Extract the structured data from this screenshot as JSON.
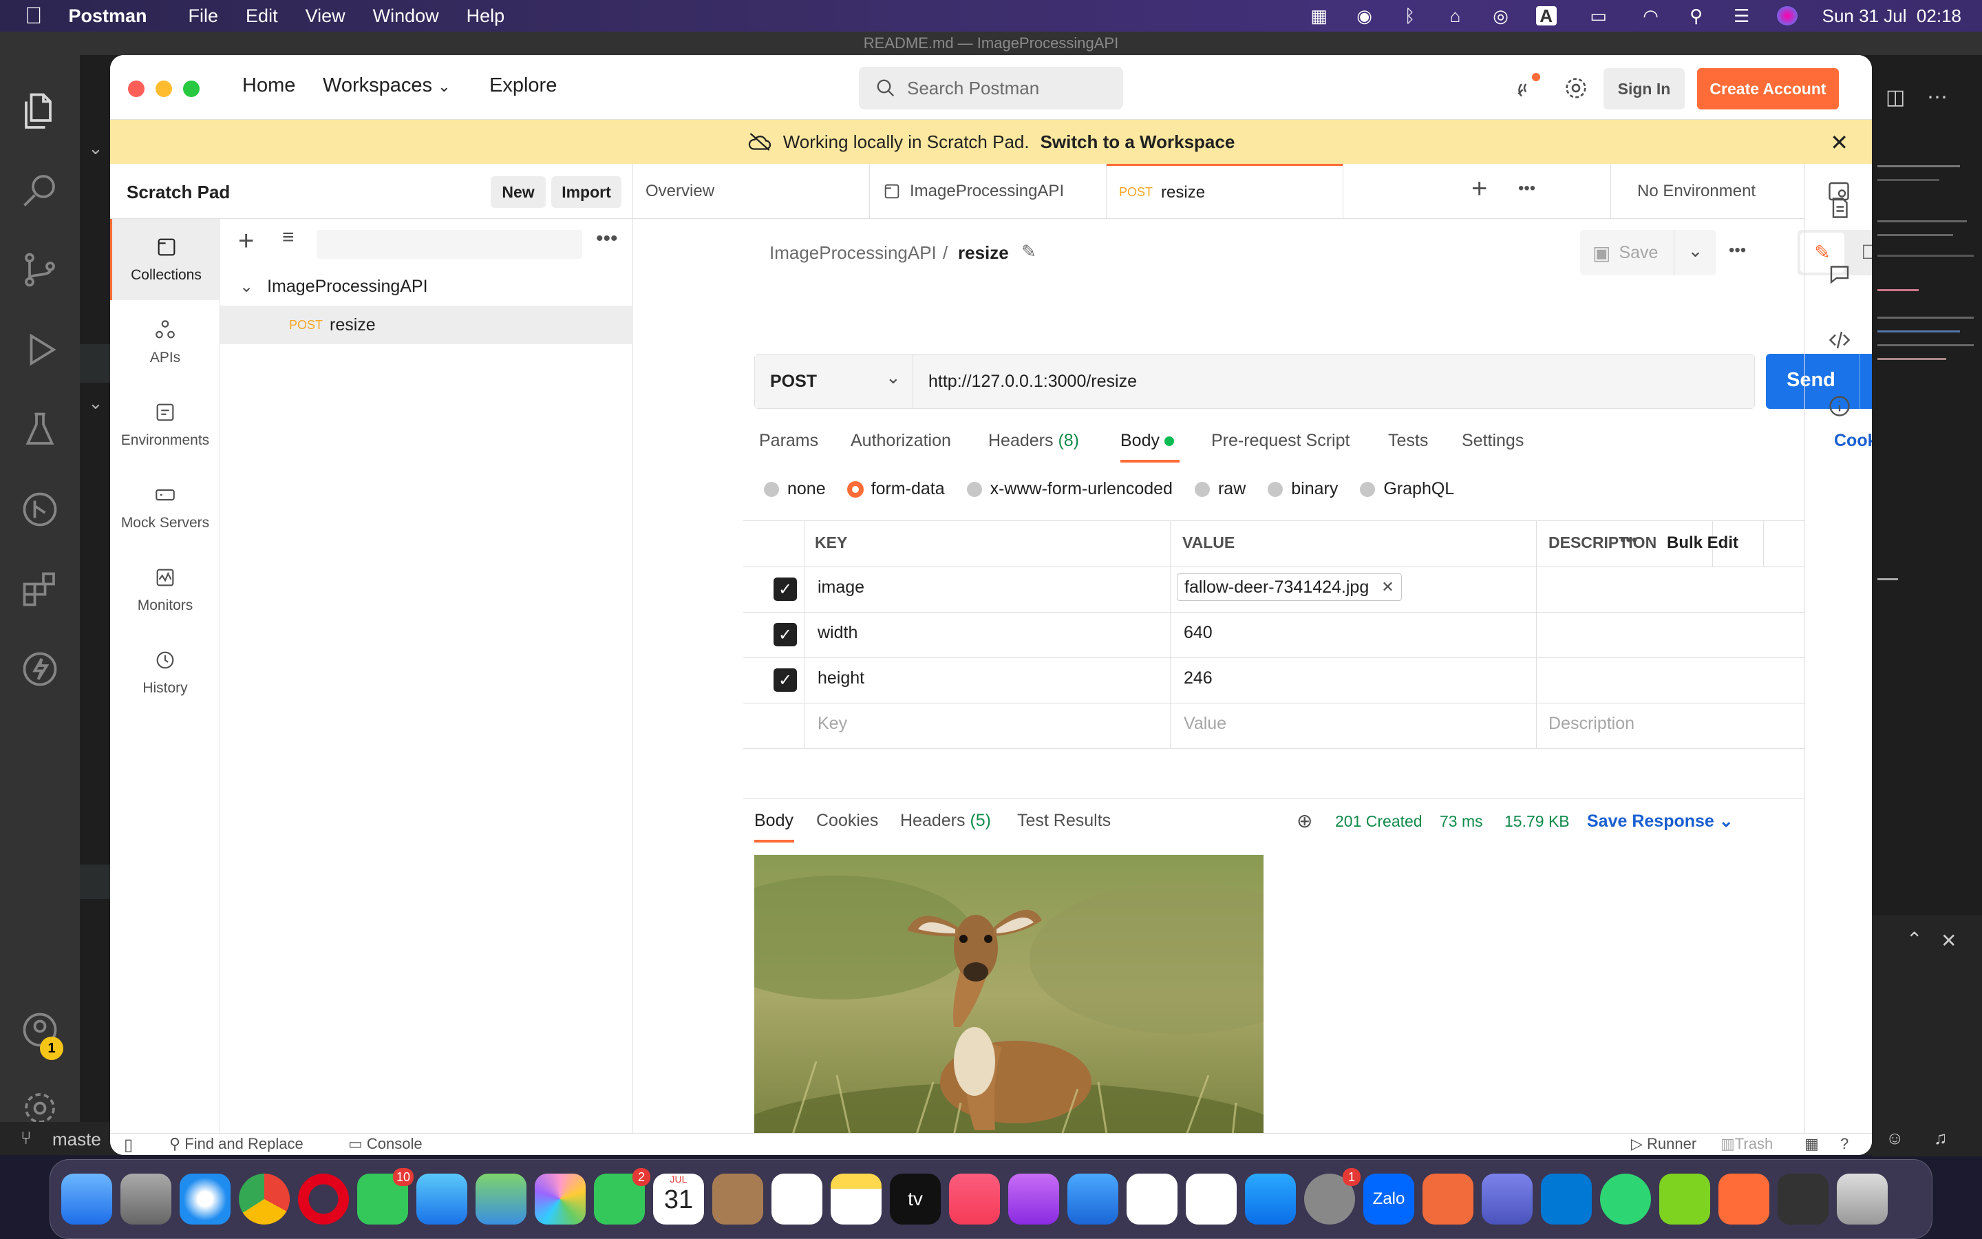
{
  "menubar": {
    "app": "Postman",
    "items": [
      "File",
      "Edit",
      "View",
      "Window",
      "Help"
    ],
    "clock": "Sun 31 Jul  02:18"
  },
  "vscode": {
    "window_title": "README.md — ImageProcessingAPI",
    "branch": "maste",
    "accounts_badge": "1"
  },
  "header": {
    "home": "Home",
    "workspaces": "Workspaces",
    "explore": "Explore",
    "search_placeholder": "Search Postman",
    "sign_in": "Sign In",
    "create_account": "Create Account"
  },
  "banner": {
    "text": "Working locally in Scratch Pad.",
    "link": "Switch to a Workspace"
  },
  "sidebar": {
    "title": "Scratch Pad",
    "new": "New",
    "import": "Import",
    "rail": [
      {
        "label": "Collections",
        "icon": "collections-icon"
      },
      {
        "label": "APIs",
        "icon": "apis-icon"
      },
      {
        "label": "Environments",
        "icon": "environments-icon"
      },
      {
        "label": "Mock Servers",
        "icon": "mock-servers-icon"
      },
      {
        "label": "Monitors",
        "icon": "monitors-icon"
      },
      {
        "label": "History",
        "icon": "history-icon"
      }
    ],
    "collection": "ImageProcessingAPI",
    "request_method": "POST",
    "request_name": "resize"
  },
  "tabs": {
    "overview": "Overview",
    "collection": "ImageProcessingAPI",
    "active_method": "POST",
    "active_name": "resize",
    "environment": "No Environment"
  },
  "request": {
    "breadcrumb_collection": "ImageProcessingAPI",
    "breadcrumb_sep": "/",
    "breadcrumb_name": "resize",
    "save": "Save",
    "method": "POST",
    "url": "http://127.0.0.1:3000/resize",
    "send": "Send",
    "subtabs": {
      "params": "Params",
      "authorization": "Authorization",
      "headers": "Headers",
      "headers_count": "(8)",
      "body": "Body",
      "prerequest": "Pre-request Script",
      "tests": "Tests",
      "settings": "Settings",
      "cookies": "Cookies"
    },
    "body_types": [
      "none",
      "form-data",
      "x-www-form-urlencoded",
      "raw",
      "binary",
      "GraphQL"
    ],
    "table": {
      "headers": {
        "key": "KEY",
        "value": "VALUE",
        "description": "DESCRIPTION",
        "bulk_edit": "Bulk Edit"
      },
      "rows": [
        {
          "key": "image",
          "value": "fallow-deer-7341424.jpg",
          "file": true
        },
        {
          "key": "width",
          "value": "640"
        },
        {
          "key": "height",
          "value": "246"
        }
      ],
      "placeholders": {
        "key": "Key",
        "value": "Value",
        "description": "Description"
      }
    }
  },
  "response": {
    "tabs": {
      "body": "Body",
      "cookies": "Cookies",
      "headers": "Headers",
      "headers_count": "(5)",
      "tests": "Test Results"
    },
    "status": "201 Created",
    "time": "73 ms",
    "size": "15.79 KB",
    "save_response": "Save Response"
  },
  "statusbar": {
    "find_replace": "Find and Replace",
    "console": "Console",
    "runner": "Runner",
    "trash": "Trash"
  },
  "dock": {
    "messages_badge": "10",
    "facetime_badge": "2",
    "calendar_month": "JUL",
    "calendar_day": "31",
    "settings_badge": "1",
    "zalo": "Zalo",
    "tv": "tv"
  },
  "colors": {
    "accent": "#ff6c37",
    "send": "#1a73e8",
    "banner": "#fce8a0",
    "status_ok": "#0f8b4a"
  }
}
